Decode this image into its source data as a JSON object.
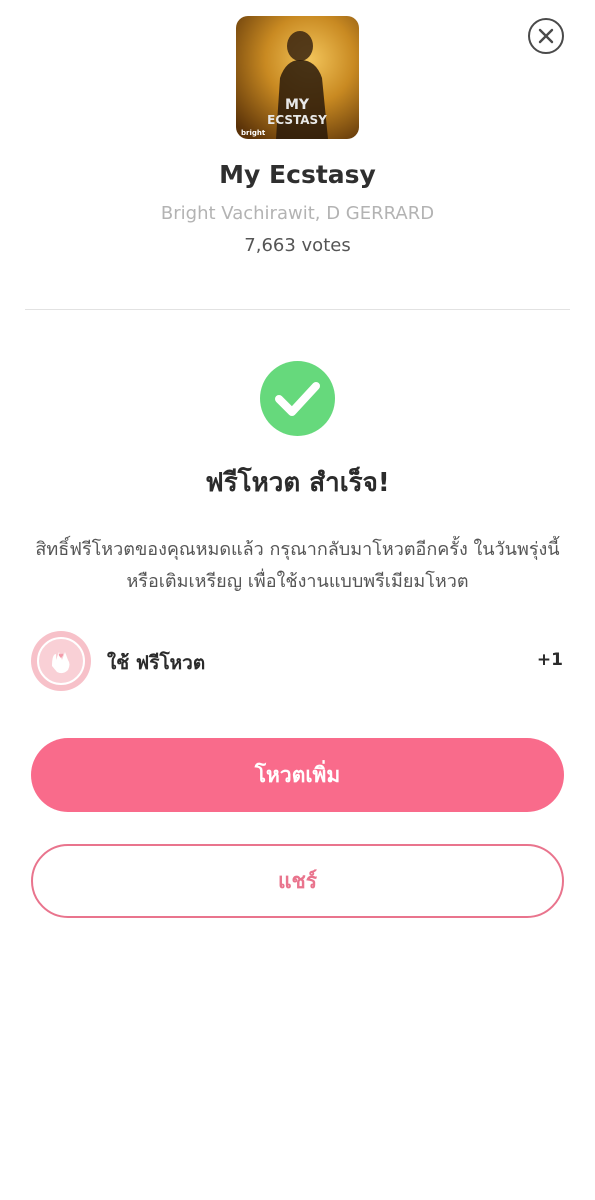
{
  "close": {
    "icon": "close-icon"
  },
  "song": {
    "cover_text_line1": "MY",
    "cover_text_line2": "ECSTASY",
    "cover_brand": "bright",
    "title": "My Ecstasy",
    "artist": "Bright Vachirawit, D GERRARD",
    "votes": "7,663 votes"
  },
  "result": {
    "icon": "check-circle-icon",
    "title": "ฟรีโหวต สำเร็จ!",
    "message": "สิทธิ์ฟรีโหวตของคุณหมดแล้ว กรุณากลับมาโหวตอีกครั้ง ในวันพรุ่งนี้ หรือเติมเหรียญ เพื่อใช้งานแบบพรีเมียมโหวต"
  },
  "vote_usage": {
    "icon": "coin-icon",
    "label": "ใช้ ฟรีโหวต",
    "count": "+1"
  },
  "actions": {
    "vote_more_label": "โหวตเพิ่ม",
    "share_label": "แชร์"
  },
  "colors": {
    "accent_pink": "#f96b8b",
    "success_green": "#66d97c",
    "coin_pink": "#f7c1c9"
  }
}
